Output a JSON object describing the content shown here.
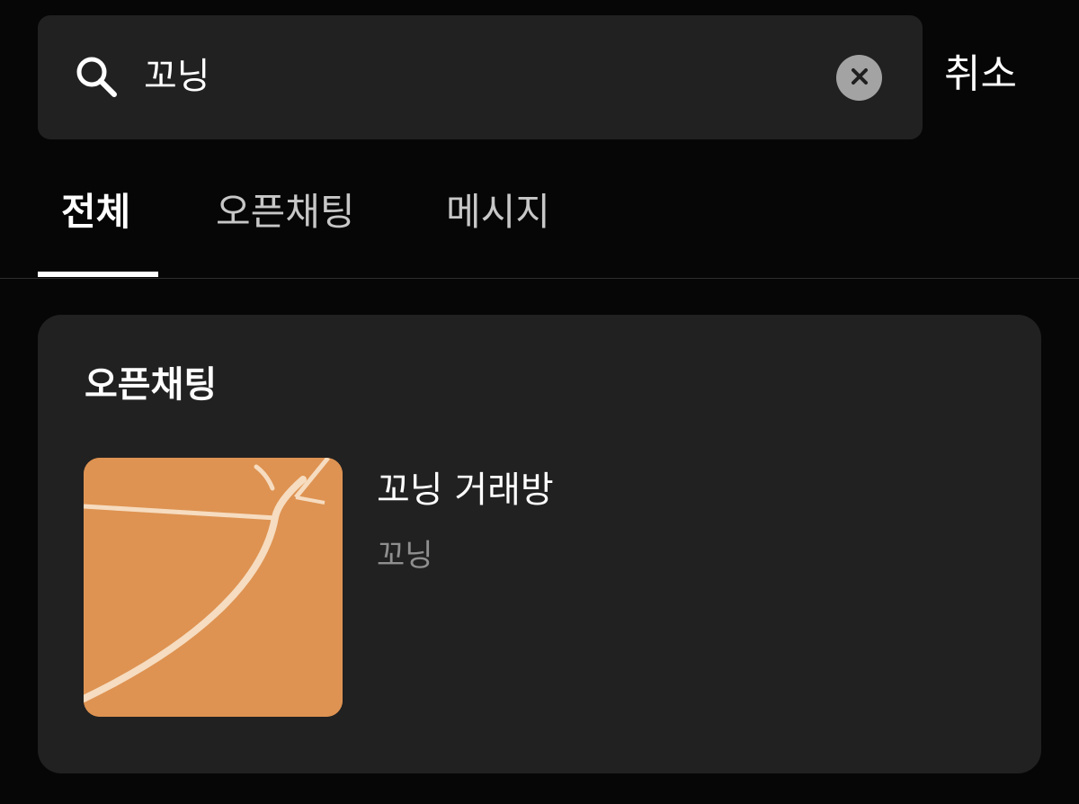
{
  "search": {
    "query": "꼬닝",
    "clear_icon": "close-icon",
    "search_icon": "search-icon",
    "cancel_label": "취소"
  },
  "tabs": [
    {
      "label": "전체",
      "active": true
    },
    {
      "label": "오픈채팅",
      "active": false
    },
    {
      "label": "메시지",
      "active": false
    }
  ],
  "results": {
    "section_title": "오픈채팅",
    "items": [
      {
        "title": "꼬닝 거래방",
        "subtitle": "꼬닝",
        "thumbnail": "basketball-court-image"
      }
    ]
  },
  "colors": {
    "background": "#060606",
    "surface": "#212121",
    "text_primary": "#ffffff",
    "text_secondary": "#8f8f8f",
    "thumbnail_orange": "#de9352"
  }
}
